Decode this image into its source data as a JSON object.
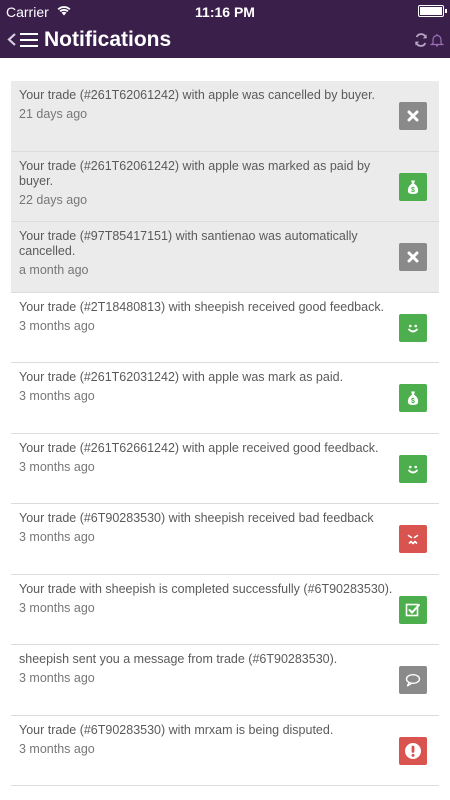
{
  "status_bar": {
    "carrier": "Carrier",
    "time": "11:16 PM"
  },
  "nav": {
    "title": "Notifications",
    "icons": [
      "back-icon",
      "menu-icon",
      "refresh-icon",
      "bell-icon"
    ]
  },
  "colors": {
    "header": "#3a1f4b",
    "unread_bg": "#ebebeb",
    "cancel": "#8a8a8a",
    "paid": "#4cae4c",
    "feedback_good": "#4cae4c",
    "feedback_bad": "#d9534f",
    "message": "#8a8a8a",
    "dispute": "#d9534f"
  },
  "notifications": [
    {
      "text": "Your trade (#261T62061242) with apple was cancelled by buyer.",
      "time": "21 days ago",
      "icon": "close-icon",
      "color": "#8a8a8a",
      "unread": true
    },
    {
      "text": "Your trade (#261T62061242) with apple was marked as paid by buyer.",
      "time": "22 days ago",
      "icon": "money-bag-icon",
      "color": "#4cae4c",
      "unread": true
    },
    {
      "text": "Your trade (#97T85417151) with santienao was automatically cancelled.",
      "time": "a month ago",
      "icon": "close-icon",
      "color": "#8a8a8a",
      "unread": true
    },
    {
      "text": "Your trade (#2T18480813) with sheepish received good feedback.",
      "time": "3 months ago",
      "icon": "smile-icon",
      "color": "#4cae4c",
      "unread": false
    },
    {
      "text": "Your trade (#261T62031242) with apple was mark as paid.",
      "time": "3 months ago",
      "icon": "money-bag-icon",
      "color": "#4cae4c",
      "unread": false
    },
    {
      "text": "Your trade (#261T62661242) with apple received good feedback.",
      "time": "3 months ago",
      "icon": "smile-icon",
      "color": "#4cae4c",
      "unread": false
    },
    {
      "text": "Your trade (#6T90283530) with sheepish received bad feedback",
      "time": "3 months ago",
      "icon": "frown-icon",
      "color": "#d9534f",
      "unread": false
    },
    {
      "text": "Your trade with sheepish is completed successfully (#6T90283530).",
      "time": "3 months ago",
      "icon": "check-square-icon",
      "color": "#4cae4c",
      "unread": false
    },
    {
      "text": "sheepish sent you a message from trade (#6T90283530).",
      "time": "3 months ago",
      "icon": "comment-icon",
      "color": "#8a8a8a",
      "unread": false
    },
    {
      "text": "Your trade (#6T90283530) with mrxam is being disputed.",
      "time": "3 months ago",
      "icon": "exclamation-icon",
      "color": "#d9534f",
      "unread": false
    }
  ]
}
